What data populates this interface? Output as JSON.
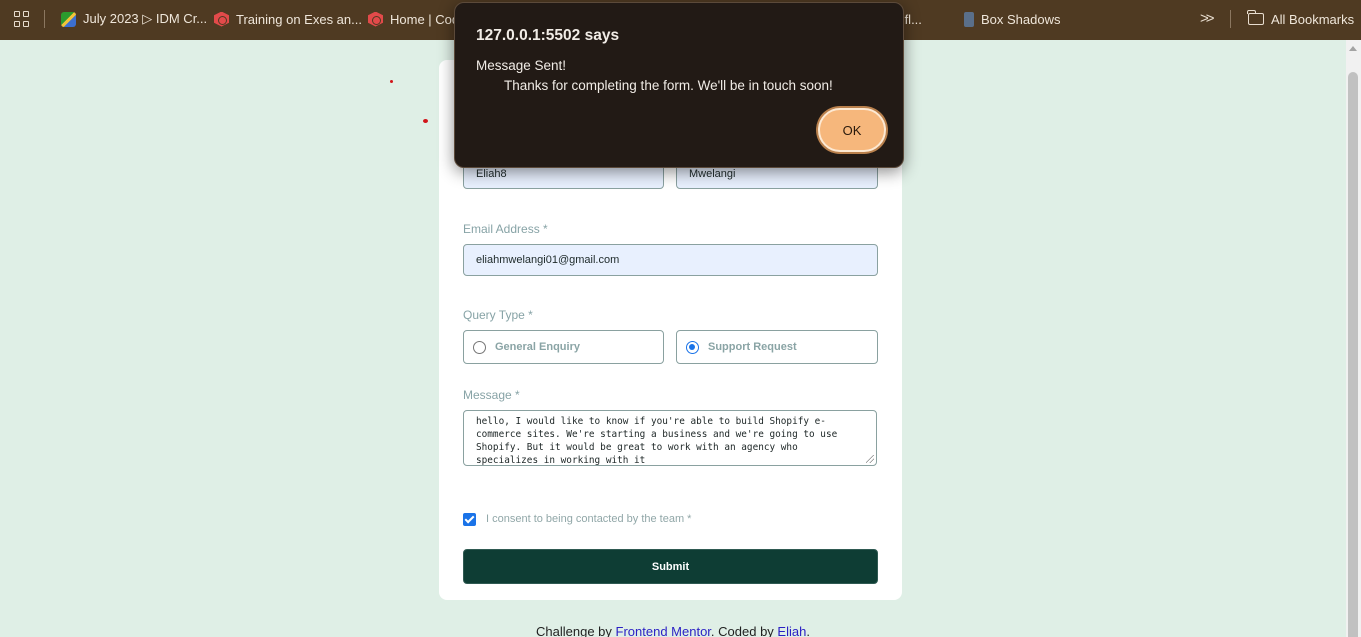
{
  "bookmarks": {
    "items": [
      {
        "label": "July 2023 ▷ IDM Cr...",
        "icon": "idm-icon"
      },
      {
        "label": "Training on Exes an...",
        "icon": "codepen-hex-icon"
      },
      {
        "label": "Home | Cod",
        "icon": "codepen-hex-icon"
      },
      {
        "label": "s of fl...",
        "icon": "page-icon"
      },
      {
        "label": "Box Shadows",
        "icon": "box-shadows-icon"
      }
    ],
    "overflow_icon": "chevron-double-right-icon",
    "all_bookmarks_label": "All Bookmarks"
  },
  "dialog": {
    "title": "127.0.0.1:5502 says",
    "message_line1": "Message Sent!",
    "message_line2": "Thanks for completing the form. We'll be in touch soon!",
    "ok_label": "OK"
  },
  "form": {
    "first_name_value": "Eliah8",
    "last_name_value": "Mwelangi",
    "email_label": "Email Address *",
    "email_value": "eliahmwelangi01@gmail.com",
    "query_type_label": "Query Type *",
    "query_options": [
      {
        "label": "General Enquiry",
        "selected": false
      },
      {
        "label": "Support Request",
        "selected": true
      }
    ],
    "message_label": "Message *",
    "message_value": "hello, I would like to know if you're able to build Shopify e-commerce sites. We're starting a business and we're going to use Shopify. But it would be great to work with an agency who specializes in working with it",
    "consent_label": "I consent to being contacted by the team *",
    "consent_checked": true,
    "submit_label": "Submit"
  },
  "footer": {
    "prefix": "Challenge by",
    "link1": "Frontend Mentor",
    "middle": ". Coded by",
    "link2": "Eliah",
    "suffix": "."
  },
  "colors": {
    "page_background": "#dfefe6",
    "bookmark_bar": "#4f3a22",
    "submit_button": "#0e3d34",
    "dialog_background": "#221a15",
    "ok_button": "#f6b77c",
    "accent_blue": "#1a73e8"
  }
}
